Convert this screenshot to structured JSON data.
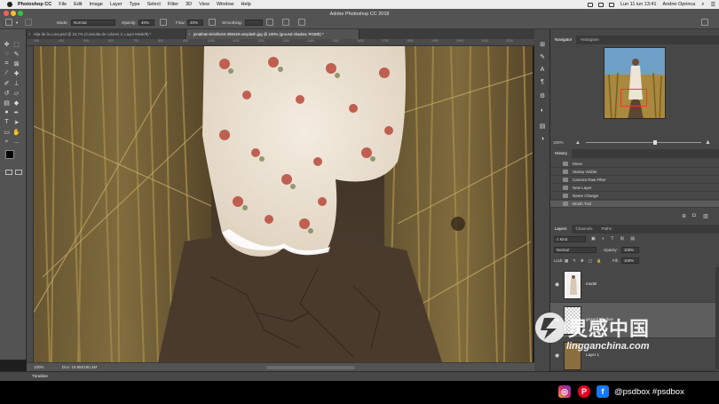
{
  "menubar": {
    "app_name": "Photoshop CC",
    "items": [
      "File",
      "Edit",
      "Image",
      "Layer",
      "Type",
      "Select",
      "Filter",
      "3D",
      "View",
      "Window",
      "Help"
    ],
    "datetime": "Lun 11 iun 13:41",
    "user": "Andrei Oprinca"
  },
  "window": {
    "title": "Adobe Photoshop CC 2018"
  },
  "options": {
    "mode_label": "Mode:",
    "mode_value": "Normal",
    "opacity_label": "Opacity:",
    "opacity_value": "40%",
    "flow_label": "Flow:",
    "flow_value": "30%",
    "smoothing_label": "Smoothing:"
  },
  "tabs": [
    {
      "label": "Hija de la Luna.psd @ 16,7% (Consulta de colores 3, Layer Mask/8) *",
      "active": false
    },
    {
      "label": "jonathan-kristihorst-398449-unsplash.jpg @ 100% (ground shadow, RGB/8) *",
      "active": true
    }
  ],
  "ruler": {
    "ticks": [
      "300",
      "400",
      "500",
      "600",
      "700",
      "800",
      "900",
      "1000",
      "1100",
      "1200",
      "1300",
      "1400",
      "1500",
      "1600",
      "1700",
      "1800",
      "1900",
      "2000",
      "2100",
      "2200"
    ]
  },
  "status": {
    "zoom": "100%",
    "doc": "Doc: 19,8M/180,4M"
  },
  "timeline": {
    "label": "Timeline"
  },
  "navigator": {
    "tabs": [
      "Navigator",
      "Histogram"
    ],
    "zoom": "100%",
    "slider_fraction": 0.6
  },
  "history": {
    "tab": "History",
    "items": [
      "Move",
      "Stamp Visible",
      "Camera Raw Filter",
      "New Layer",
      "Name Change",
      "Brush Tool"
    ],
    "active_index": 5
  },
  "layers": {
    "tabs": [
      "Layers",
      "Channels",
      "Paths"
    ],
    "kind": "Kind",
    "blend_mode": "Normal",
    "opacity_label": "Opacity:",
    "opacity_value": "100%",
    "lock_label": "Lock:",
    "fill_label": "Fill:",
    "fill_value": "100%",
    "items": [
      {
        "name": "model",
        "active": false
      },
      {
        "name": "ground shadow",
        "active": true
      },
      {
        "name": "Layer 1",
        "active": false
      }
    ]
  },
  "watermark": {
    "cn_text": "灵感中国",
    "url": "lingganchina.com"
  },
  "social": {
    "handles": "@psdbox #psdbox"
  }
}
